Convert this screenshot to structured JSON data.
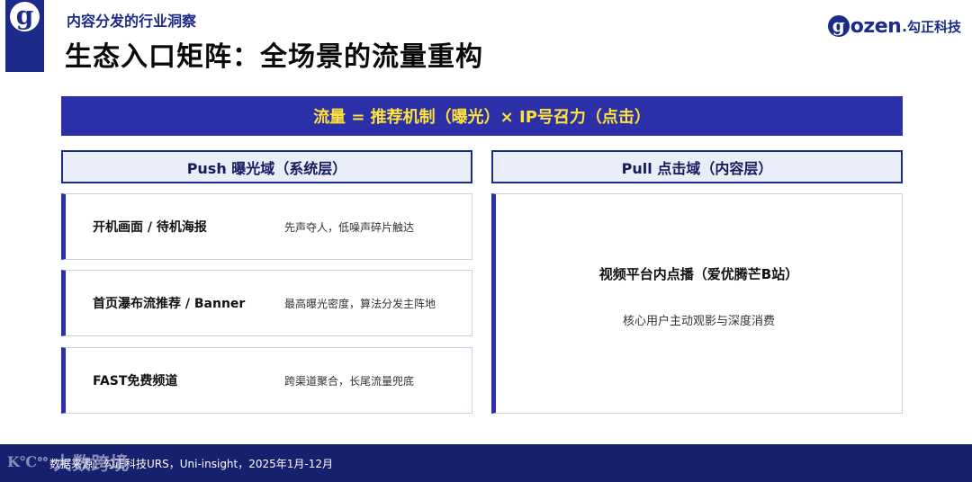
{
  "header": {
    "subtitle": "内容分发的行业洞察",
    "title": "生态入口矩阵：全场景的流量重构",
    "logo_glyph": "g",
    "brand_glyph": "g",
    "brand_word": "ozen",
    "brand_cn": ".勾正科技"
  },
  "banner": {
    "formula": "流量 = 推荐机制（曝光）× IP号召力（点击）",
    "text_color": "#ffe13a",
    "background": "#2b2fa8"
  },
  "push": {
    "header": "Push 曝光域（系统层）",
    "items": [
      {
        "label": "开机画面 / 待机海报",
        "desc": "先声夺人，低噪声碎片触达"
      },
      {
        "label": "首页瀑布流推荐 / Banner",
        "desc": "最高曝光密度，算法分发主阵地"
      },
      {
        "label": "FAST免费频道",
        "desc": "跨渠道聚合，长尾流量兜底"
      }
    ]
  },
  "pull": {
    "header": "Pull 点击域（内容层）",
    "title": "视频平台内点播（爱优腾芒B站）",
    "desc": "核心用户主动观影与深度消费"
  },
  "footer": {
    "source": "数据来源：勾正科技URS，Uni-insight，2025年1月-12月",
    "watermark_mark": "K℃ᐤᐤ",
    "watermark_text": "大数跨境"
  },
  "colors": {
    "brand_navy": "#1c2a8a",
    "footer_bg": "#16206e",
    "header_bg": "#e9eef8"
  }
}
